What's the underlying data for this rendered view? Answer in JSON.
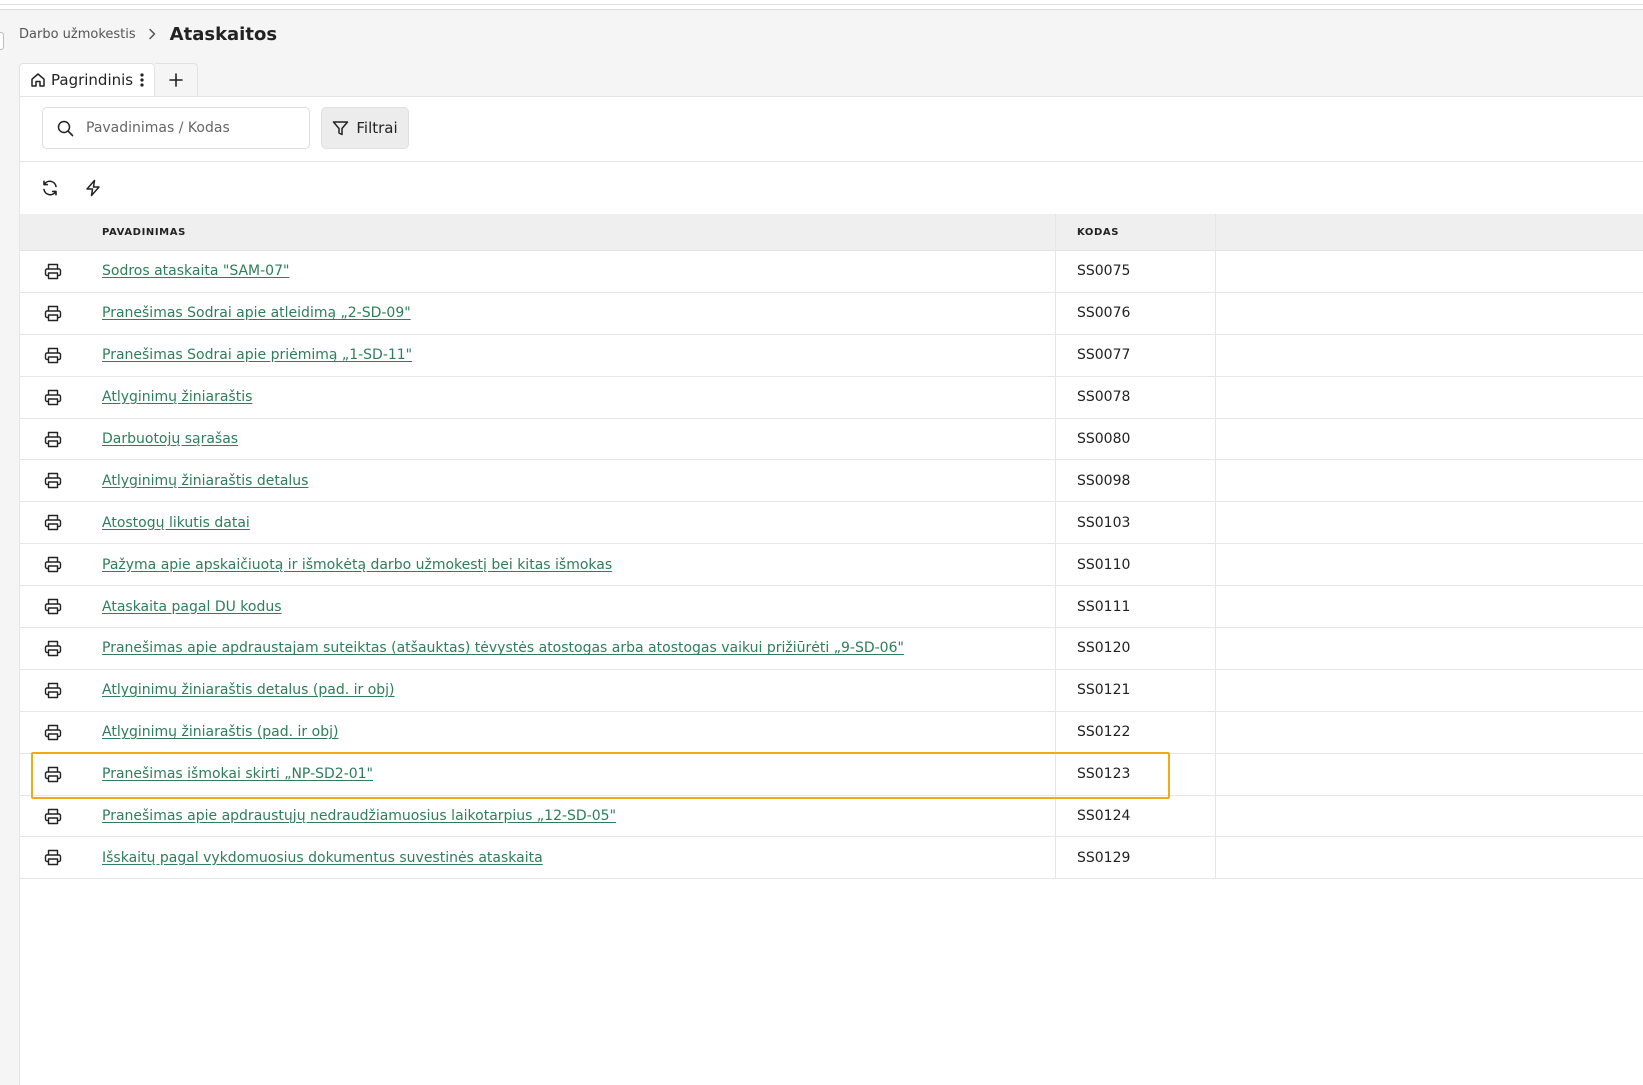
{
  "breadcrumb": {
    "parent": "Darbo užmokestis",
    "current": "Ataskaitos"
  },
  "tabs": [
    {
      "label": "Pagrindinis"
    }
  ],
  "search": {
    "placeholder": "Pavadinimas / Kodas",
    "value": ""
  },
  "filter": {
    "label": "Filtrai"
  },
  "toolbar": {
    "icons": [
      "refresh-icon",
      "lightning-icon"
    ]
  },
  "table": {
    "headers": {
      "name": "PAVADINIMAS",
      "code": "KODAS"
    },
    "rows": [
      {
        "name": "Sodros ataskaita \"SAM-07\"",
        "code": "SS0075"
      },
      {
        "name": "Pranešimas Sodrai apie atleidimą „2-SD-09\"",
        "code": "SS0076"
      },
      {
        "name": "Pranešimas Sodrai apie priėmimą „1-SD-11\"",
        "code": "SS0077"
      },
      {
        "name": "Atlyginimų žiniaraštis",
        "code": "SS0078"
      },
      {
        "name": "Darbuotojų sąrašas",
        "code": "SS0080"
      },
      {
        "name": "Atlyginimų žiniaraštis detalus",
        "code": "SS0098"
      },
      {
        "name": "Atostogų likutis datai",
        "code": "SS0103"
      },
      {
        "name": "Pažyma apie apskaičiuotą ir išmokėtą darbo užmokestį bei kitas išmokas",
        "code": "SS0110"
      },
      {
        "name": "Ataskaita pagal DU kodus",
        "code": "SS0111"
      },
      {
        "name": "Pranešimas apie apdraustajam suteiktas (atšauktas) tėvystės atostogas arba atostogas vaikui prižiūrėti „9-SD-06\"",
        "code": "SS0120"
      },
      {
        "name": "Atlyginimų žiniaraštis detalus (pad. ir obj)",
        "code": "SS0121"
      },
      {
        "name": "Atlyginimų žiniaraštis (pad. ir obj)",
        "code": "SS0122"
      },
      {
        "name": "Pranešimas išmokai skirti „NP-SD2-01\"",
        "code": "SS0123"
      },
      {
        "name": "Pranešimas apie apdraustųjų nedraudžiamuosius laikotarpius „12-SD-05\"",
        "code": "SS0124"
      },
      {
        "name": "Išskaitų pagal vykdomuosius dokumentus suvestinės ataskaita",
        "code": "SS0129"
      }
    ]
  },
  "colors": {
    "link": "#2e7d5c",
    "highlight": "#f5a816",
    "background": "#f5f5f6"
  }
}
